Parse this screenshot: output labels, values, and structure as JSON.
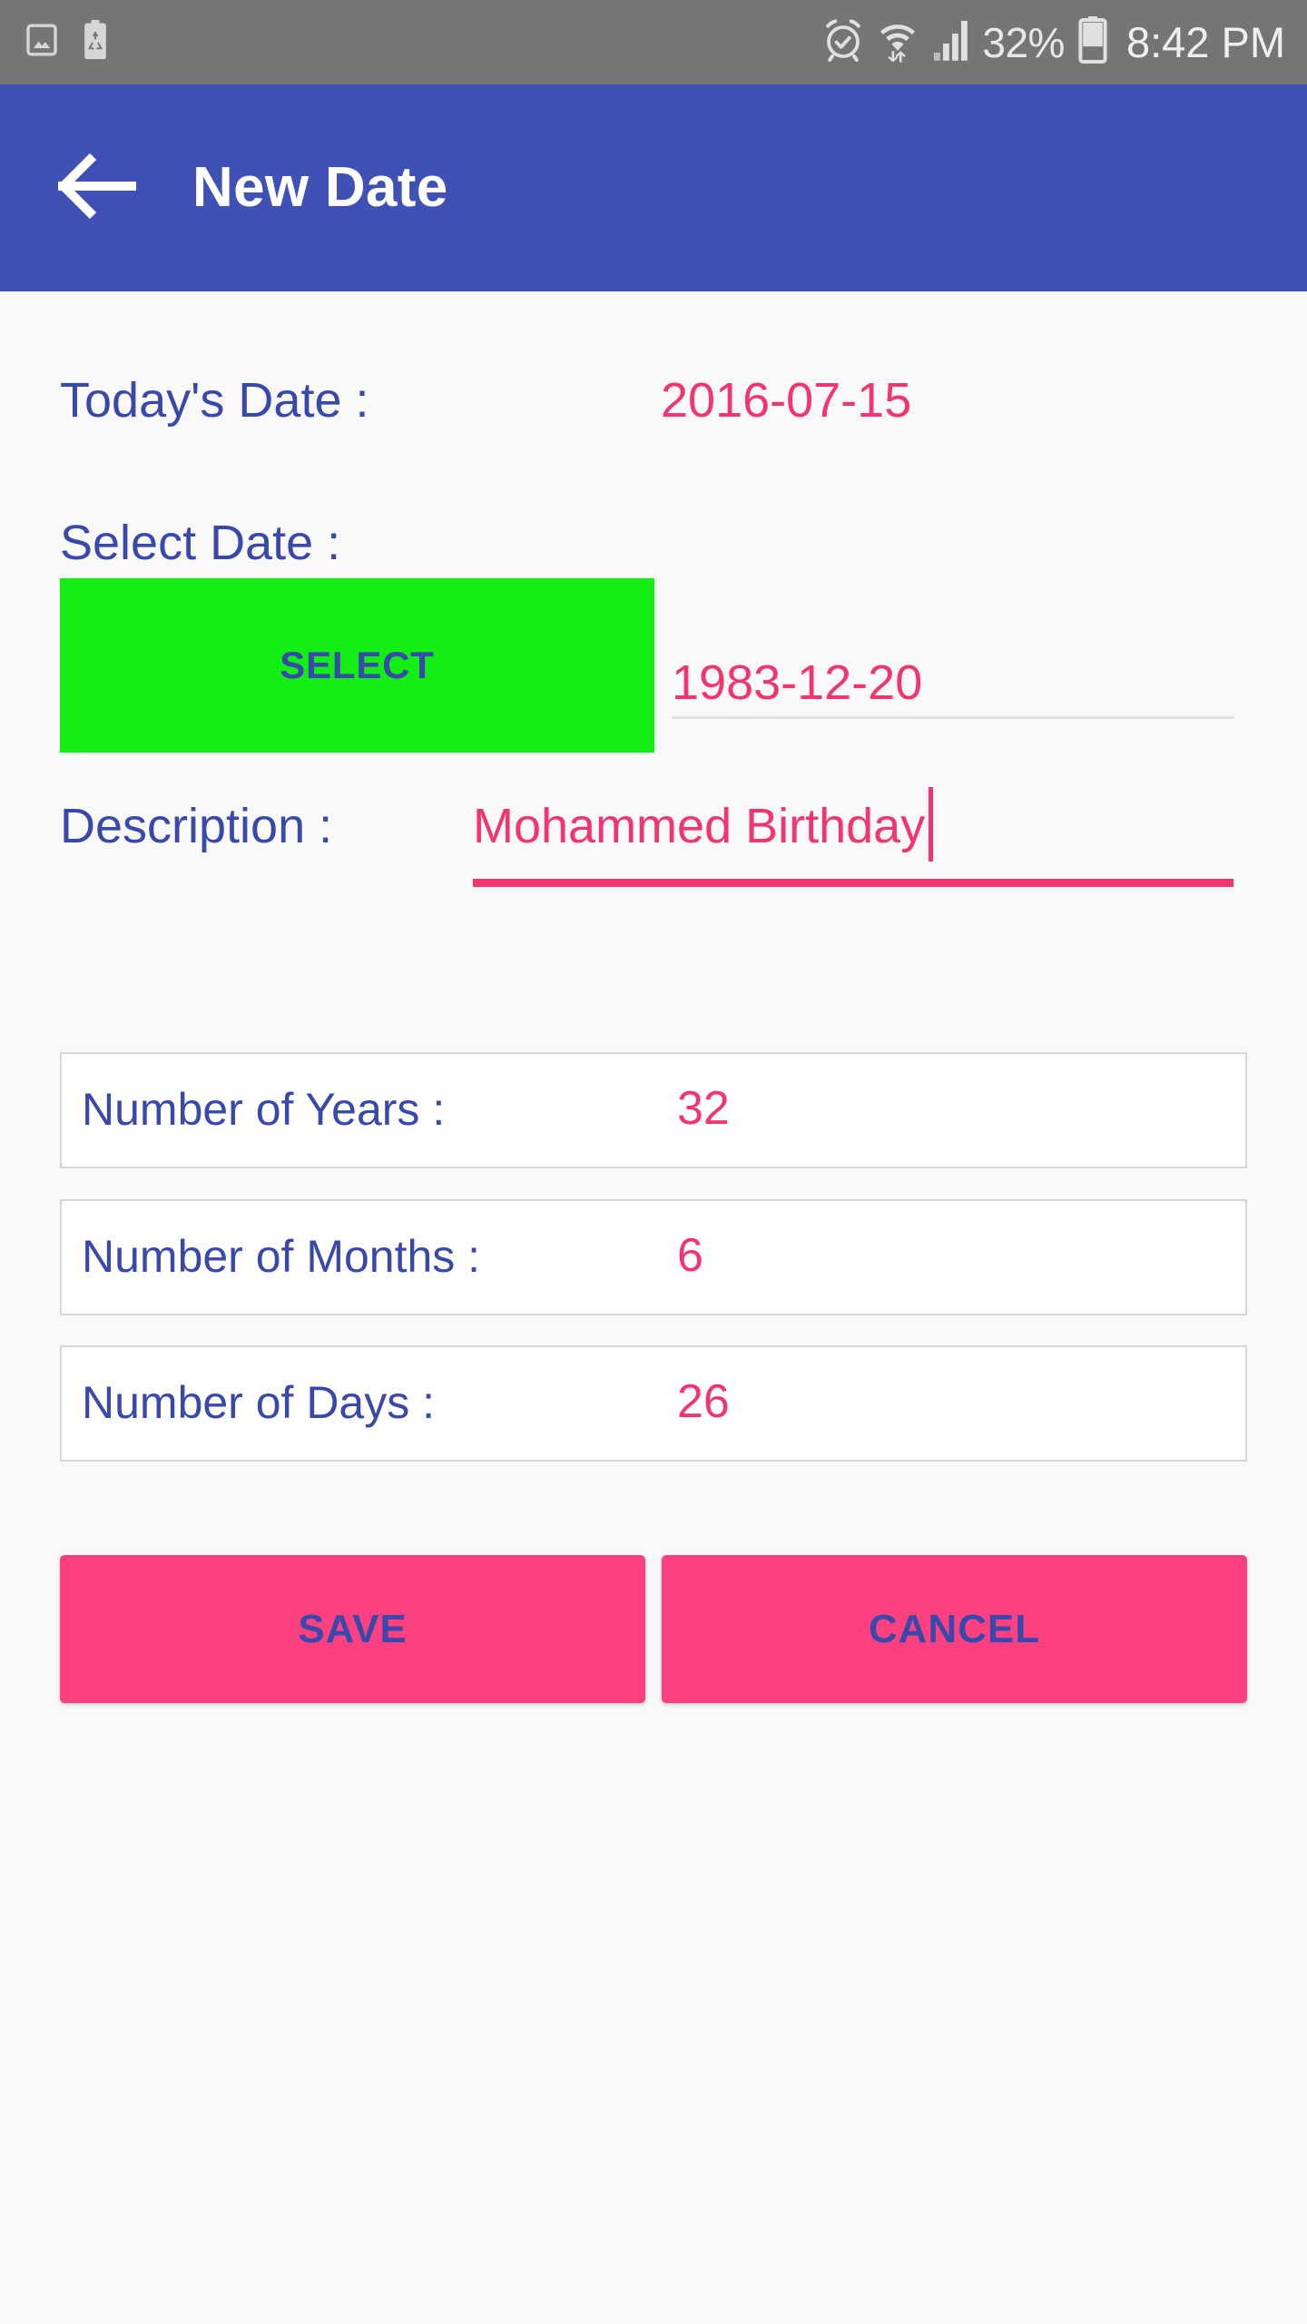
{
  "status_bar": {
    "left_icons": [
      "image-icon",
      "battery-recycle-icon"
    ],
    "right_icons": [
      "alarm-clock-icon",
      "wifi-icon",
      "signal-bars-icon",
      "battery-icon"
    ],
    "battery_percent": "32%",
    "time": "8:42 PM",
    "background_color": "#757575"
  },
  "app_bar": {
    "back_icon": "back-arrow-icon",
    "title": "New Date",
    "background_color": "#3f51b5",
    "title_color": "#ffffff"
  },
  "form": {
    "today": {
      "label": "Today's Date :",
      "value": "2016-07-15"
    },
    "select_date": {
      "label": "Select Date :",
      "button_label": "SELECT",
      "button_color": "#14ee14",
      "selected_value": "1983-12-20"
    },
    "description": {
      "label": "Description :",
      "value": "Mohammed Birthday",
      "placeholder": "",
      "underline_color": "#f2356e",
      "focused": true
    },
    "info_rows": [
      {
        "label": "Number of Years :",
        "value": "32"
      },
      {
        "label": "Number of Months :",
        "value": "6"
      },
      {
        "label": "Number of Days :",
        "value": "26"
      }
    ],
    "actions": {
      "save_label": "SAVE",
      "cancel_label": "CANCEL",
      "button_color": "#fc4080",
      "button_text_color": "#3949ab"
    }
  },
  "colors": {
    "label_blue": "#3949ab",
    "value_pink": "#f2356e",
    "page_background": "#f9f9f9"
  }
}
